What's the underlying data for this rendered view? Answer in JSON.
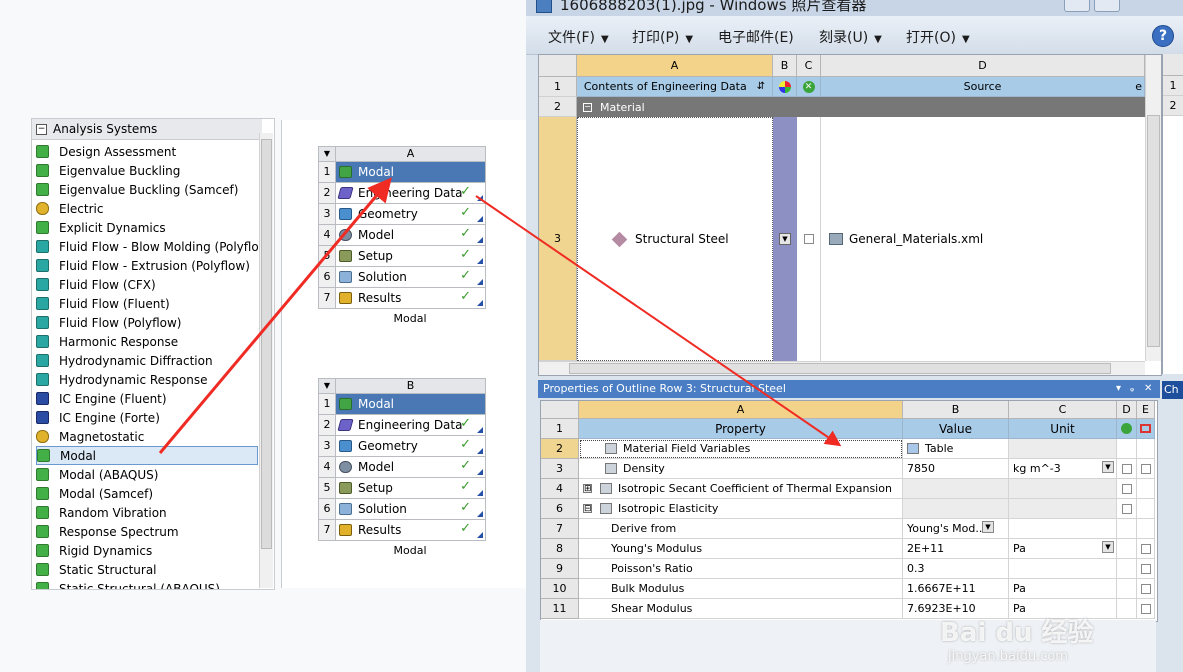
{
  "toolbox": {
    "header": "Analysis Systems",
    "items": [
      {
        "label": "Design Assessment",
        "icon": "design-assessment-icon"
      },
      {
        "label": "Eigenvalue Buckling",
        "icon": "eigenvalue-buckling-icon"
      },
      {
        "label": "Eigenvalue Buckling (Samcef)",
        "icon": "eigenvalue-buckling-icon"
      },
      {
        "label": "Electric",
        "icon": "electric-icon"
      },
      {
        "label": "Explicit Dynamics",
        "icon": "explicit-dynamics-icon"
      },
      {
        "label": "Fluid Flow - Blow Molding (Polyflo",
        "icon": "fluid-flow-icon"
      },
      {
        "label": "Fluid Flow - Extrusion (Polyflow)",
        "icon": "fluid-flow-icon"
      },
      {
        "label": "Fluid Flow (CFX)",
        "icon": "fluid-flow-icon"
      },
      {
        "label": "Fluid Flow (Fluent)",
        "icon": "fluid-flow-icon"
      },
      {
        "label": "Fluid Flow (Polyflow)",
        "icon": "fluid-flow-icon"
      },
      {
        "label": "Harmonic Response",
        "icon": "harmonic-response-icon"
      },
      {
        "label": "Hydrodynamic Diffraction",
        "icon": "hydrodynamic-icon"
      },
      {
        "label": "Hydrodynamic Response",
        "icon": "hydrodynamic-icon"
      },
      {
        "label": "IC Engine (Fluent)",
        "icon": "ic-engine-icon"
      },
      {
        "label": "IC Engine (Forte)",
        "icon": "ic-engine-icon"
      },
      {
        "label": "Magnetostatic",
        "icon": "magnetostatic-icon"
      },
      {
        "label": "Modal",
        "icon": "modal-icon",
        "selected": true
      },
      {
        "label": "Modal (ABAQUS)",
        "icon": "modal-icon"
      },
      {
        "label": "Modal (Samcef)",
        "icon": "modal-icon"
      },
      {
        "label": "Random Vibration",
        "icon": "random-vibration-icon"
      },
      {
        "label": "Response Spectrum",
        "icon": "response-spectrum-icon"
      },
      {
        "label": "Rigid Dynamics",
        "icon": "rigid-dynamics-icon"
      },
      {
        "label": "Static Structural",
        "icon": "static-structural-icon"
      },
      {
        "label": "Static Structural (ABAQUS)",
        "icon": "static-structural-icon"
      }
    ]
  },
  "schematic": {
    "systems": [
      {
        "letter": "A",
        "caption": "Modal",
        "rows": [
          {
            "num": "1",
            "label": "Modal",
            "icon": "modal",
            "title": true
          },
          {
            "num": "2",
            "label": "Engineering Data",
            "icon": "eng",
            "check": "✓"
          },
          {
            "num": "3",
            "label": "Geometry",
            "icon": "geo",
            "check": "✓"
          },
          {
            "num": "4",
            "label": "Model",
            "icon": "model",
            "check": "✓"
          },
          {
            "num": "5",
            "label": "Setup",
            "icon": "setup",
            "check": "✓"
          },
          {
            "num": "6",
            "label": "Solution",
            "icon": "sol",
            "check": "✓"
          },
          {
            "num": "7",
            "label": "Results",
            "icon": "res",
            "check": "✓"
          }
        ]
      },
      {
        "letter": "B",
        "caption": "Modal",
        "rows": [
          {
            "num": "1",
            "label": "Modal",
            "icon": "modal",
            "title": true
          },
          {
            "num": "2",
            "label": "Engineering Data",
            "icon": "eng",
            "check": "✓"
          },
          {
            "num": "3",
            "label": "Geometry",
            "icon": "geo",
            "check": "✓"
          },
          {
            "num": "4",
            "label": "Model",
            "icon": "model",
            "check": "✓"
          },
          {
            "num": "5",
            "label": "Setup",
            "icon": "setup",
            "check": "✓"
          },
          {
            "num": "6",
            "label": "Solution",
            "icon": "sol",
            "check": "✓"
          },
          {
            "num": "7",
            "label": "Results",
            "icon": "res",
            "check": "✓"
          }
        ]
      }
    ]
  },
  "viewer": {
    "title": "1606888203(1).jpg - Windows 照片查看器",
    "menu": [
      {
        "label": "文件(F)",
        "dropdown": true
      },
      {
        "label": "打印(P)",
        "dropdown": true
      },
      {
        "label": "电子邮件(E)",
        "dropdown": false
      },
      {
        "label": "刻录(U)",
        "dropdown": true
      },
      {
        "label": "打开(O)",
        "dropdown": true
      }
    ],
    "help": "?"
  },
  "outline": {
    "columns": [
      "A",
      "B",
      "C",
      "D"
    ],
    "header_contents": "Contents of Engineering Data",
    "header_source": "Source",
    "header_cut": "e",
    "row_nums": [
      "1",
      "2",
      "3"
    ],
    "group_label": "Material",
    "material_name": "Structural Steel",
    "material_source": "General_Materials.xml"
  },
  "right_panel": {
    "row_nums": [
      "1",
      "2"
    ],
    "chart_tab": "Ch"
  },
  "properties": {
    "title": "Properties of Outline Row 3: Structural Steel",
    "title_buttons": [
      "▾",
      "ᵩ",
      "✕"
    ],
    "columns": [
      "A",
      "B",
      "C",
      "D",
      "E"
    ],
    "header": {
      "property": "Property",
      "value": "Value",
      "unit": "Unit"
    },
    "rows": [
      {
        "num": "2",
        "property": "Material Field Variables",
        "value": "Table",
        "unit": "",
        "indent": 1,
        "icon": true,
        "expander": ""
      },
      {
        "num": "3",
        "property": "Density",
        "value": "7850",
        "unit": "kg m^-3",
        "indent": 1,
        "icon": true,
        "expander": "",
        "unit_dd": true
      },
      {
        "num": "4",
        "property": "Isotropic Secant Coefficient of Thermal Expansion",
        "value": "",
        "unit": "",
        "indent": 0,
        "icon": true,
        "expander": "⊞"
      },
      {
        "num": "6",
        "property": "Isotropic Elasticity",
        "value": "",
        "unit": "",
        "indent": 0,
        "icon": true,
        "expander": "⊟"
      },
      {
        "num": "7",
        "property": "Derive from",
        "value": "Young's Mod...",
        "unit": "",
        "indent": 2,
        "icon": false,
        "expander": "",
        "value_dd": true
      },
      {
        "num": "8",
        "property": "Young's Modulus",
        "value": "2E+11",
        "unit": "Pa",
        "indent": 2,
        "icon": false,
        "expander": "",
        "unit_dd": true
      },
      {
        "num": "9",
        "property": "Poisson's Ratio",
        "value": "0.3",
        "unit": "",
        "indent": 2,
        "icon": false,
        "expander": ""
      },
      {
        "num": "10",
        "property": "Bulk Modulus",
        "value": "1.6667E+11",
        "unit": "Pa",
        "indent": 2,
        "icon": false,
        "expander": ""
      },
      {
        "num": "11",
        "property": "Shear Modulus",
        "value": "7.6923E+10",
        "unit": "Pa",
        "indent": 2,
        "icon": false,
        "expander": ""
      }
    ]
  },
  "watermark": {
    "logo": "Bai du 经验",
    "url": "jingyan.baidu.com"
  },
  "colors": {
    "annotation_arrow": "#ef2b24",
    "selection_blue": "#4a78b5",
    "header_blue": "#a8cbe8",
    "row_highlight": "#f0d591"
  }
}
